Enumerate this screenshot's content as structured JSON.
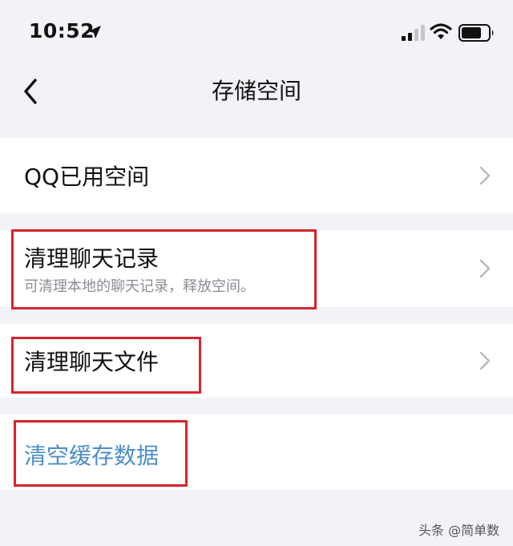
{
  "status_bar": {
    "time": "10:52",
    "icons": [
      "location-arrow-icon",
      "cellular-signal-icon",
      "wifi-icon",
      "battery-icon"
    ]
  },
  "nav": {
    "back_icon": "chevron-left-icon",
    "title": "存储空间"
  },
  "rows": [
    {
      "label": "QQ已用空间",
      "subtitle": ""
    },
    {
      "label": "清理聊天记录",
      "subtitle": "可清理本地的聊天记录，释放空间。"
    },
    {
      "label": "清理聊天文件",
      "subtitle": ""
    },
    {
      "label": "清空缓存数据",
      "subtitle": ""
    }
  ],
  "colors": {
    "background": "#f1f3f7",
    "row_background": "#ffffff",
    "primary_text": "#111111",
    "secondary_text": "#8a8d93",
    "link_text": "#4a8ec9",
    "chevron": "#b6b9bf",
    "annotation_box": "#d3262c"
  },
  "watermark": "头条 @简单数"
}
